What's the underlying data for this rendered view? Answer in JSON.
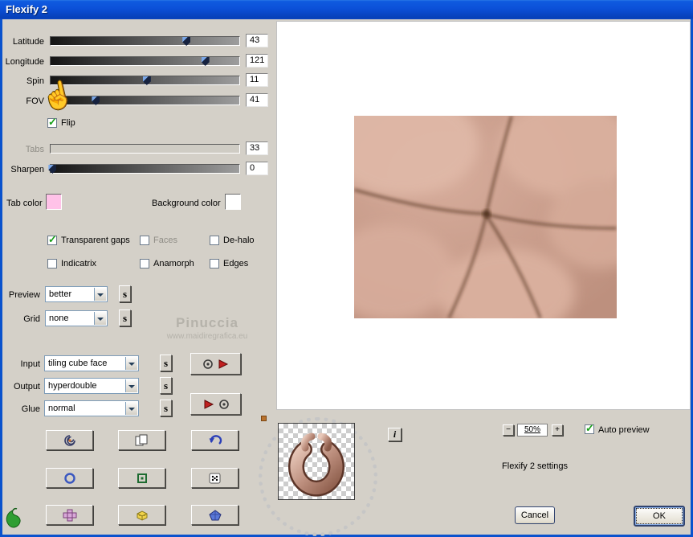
{
  "window": {
    "title": "Flexify 2"
  },
  "sliders": [
    {
      "label": "Latitude",
      "value": "43",
      "pct": 72,
      "enabled": true
    },
    {
      "label": "Longitude",
      "value": "121",
      "pct": 82,
      "enabled": true
    },
    {
      "label": "Spin",
      "value": "11",
      "pct": 51,
      "enabled": true
    },
    {
      "label": "FOV",
      "value": "41",
      "pct": 24,
      "enabled": true
    },
    {
      "label": "Tabs",
      "value": "33",
      "pct": 33,
      "enabled": false
    },
    {
      "label": "Sharpen",
      "value": "0",
      "pct": 1,
      "enabled": true
    }
  ],
  "checkboxes": {
    "flip": {
      "label": "Flip",
      "checked": true
    },
    "transparent_gaps": {
      "label": "Transparent gaps",
      "checked": true
    },
    "faces": {
      "label": "Faces",
      "checked": false
    },
    "dehalo": {
      "label": "De-halo",
      "checked": false
    },
    "indicatrix": {
      "label": "Indicatrix",
      "checked": false
    },
    "anamorph": {
      "label": "Anamorph",
      "checked": false
    },
    "edges": {
      "label": "Edges",
      "checked": false
    },
    "auto_preview": {
      "label": "Auto preview",
      "checked": true
    }
  },
  "colors": {
    "tab_color_label": "Tab color",
    "tab_color": "#ffc2e8",
    "background_color_label": "Background color",
    "background_color": "#ffffff"
  },
  "dropdowns": {
    "preview": {
      "label": "Preview",
      "value": "better"
    },
    "grid": {
      "label": "Grid",
      "value": "none"
    },
    "input": {
      "label": "Input",
      "value": "tiling cube face"
    },
    "output": {
      "label": "Output",
      "value": "hyperdouble"
    },
    "glue": {
      "label": "Glue",
      "value": "normal"
    }
  },
  "watermark": {
    "name": "Pinuccia",
    "site": "www.maidiregrafica.eu"
  },
  "buttons": {
    "s": "s",
    "info": "i",
    "cancel": "Cancel",
    "ok": "OK"
  },
  "zoom": {
    "minus": "−",
    "value": "50%",
    "plus": "+"
  },
  "footer": {
    "settings": "Flexify 2 settings"
  },
  "icon_buttons": [
    "spiral",
    "copy",
    "undo",
    "ring",
    "square",
    "dice",
    "plus",
    "cube",
    "gem"
  ]
}
